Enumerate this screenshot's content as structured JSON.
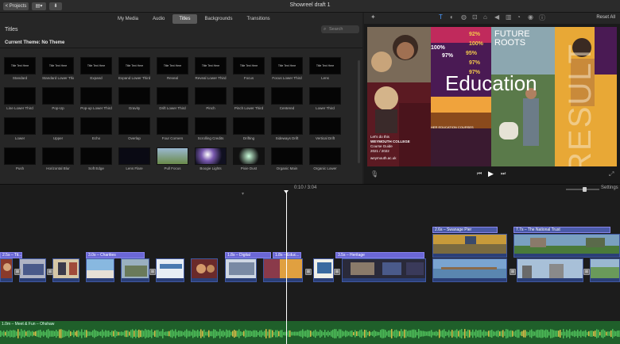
{
  "topbar": {
    "projects_label": "< Projects",
    "doc_title": "Showreel draft 1"
  },
  "browser": {
    "tabs": [
      {
        "label": "My Media",
        "active": false
      },
      {
        "label": "Audio",
        "active": false
      },
      {
        "label": "Titles",
        "active": true
      },
      {
        "label": "Backgrounds",
        "active": false
      },
      {
        "label": "Transitions",
        "active": false
      }
    ],
    "heading": "Titles",
    "search_placeholder": "Search",
    "current_theme": "Current Theme: No Theme",
    "titles": [
      "Standard",
      "Standard Lower Third",
      "Expand",
      "Expand Lower Third",
      "Reveal",
      "Reveal Lower Third",
      "Focus",
      "Focus Lower Third",
      "Lens",
      "Line Lower Third",
      "Pop-Up",
      "Pop-up Lower Third",
      "Gravity",
      "Drift Lower Third",
      "Pinch",
      "Pinch Lower Third",
      "Centered",
      "Lower Third",
      "Lower",
      "Upper",
      "Echo",
      "Overlap",
      "Four Corners",
      "Scrolling Credits",
      "Drifting",
      "Sideways Drift",
      "Vertical Drift",
      "Push",
      "Horizontal Blur",
      "Soft Edge",
      "Lens Flare",
      "Pull Focus",
      "Boogie Lights",
      "Pixie Dust",
      "Organic Main",
      "Organic Lower"
    ],
    "tiny_thumb_text": "Title Text Here"
  },
  "viewer": {
    "reset_all": "Reset All",
    "frame": {
      "big_word": "Education",
      "future_text": "FUTURE\nROOTS",
      "college_line1": "Let's do this",
      "college_name": "WEYMOUTH COLLEGE",
      "course_guide": "Course Guide",
      "year": "2021 / 2022",
      "url": "weymouth.ac.uk",
      "stats": [
        "100%",
        "97%",
        "92%",
        "95%",
        "100%",
        "97%",
        "97%"
      ],
      "results": "RESULT",
      "education_courses": "HER EDUCATION COURSES"
    }
  },
  "timeline": {
    "timecode": "0:10 / 3:04",
    "settings_label": "Settings",
    "title_clips": [
      "2.5s – Tit...",
      "3.0s – Charities",
      "1.8s – Digital",
      "1.8s – Educ...",
      "3.5s – Heritage"
    ],
    "broll_clips": [
      "2.6s – Swanage Pier",
      "7.7s – The National Trust"
    ],
    "audio_label": "1.0m – Meet & Fun – Ohshaw"
  },
  "colors": {
    "title_bar": "#6b67d6",
    "clip_blue": "#2b3f77",
    "audio_green": "#1f5f2a"
  }
}
